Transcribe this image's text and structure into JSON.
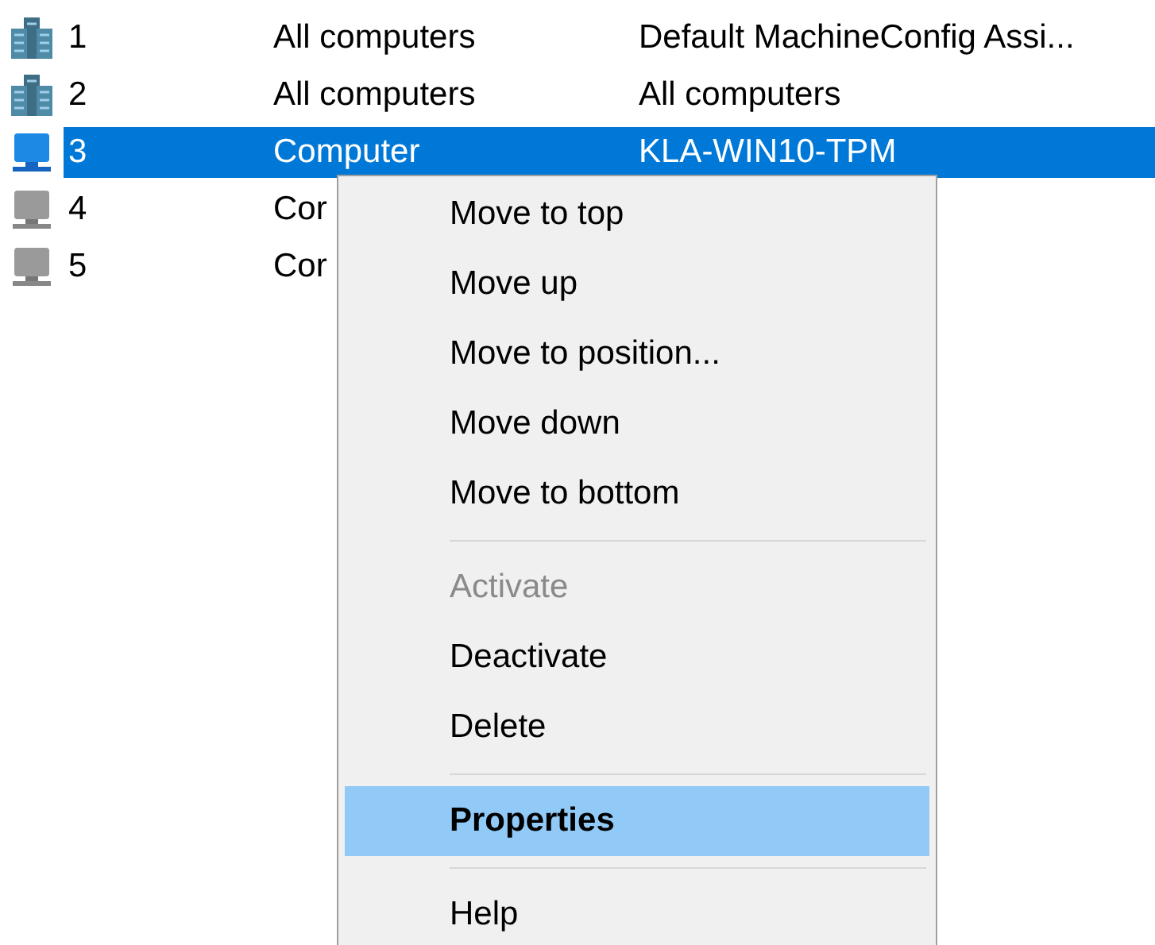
{
  "rows": [
    {
      "kind": "group",
      "number": "1",
      "scope": "All computers",
      "target": "Default MachineConfig Assi...",
      "selected": false
    },
    {
      "kind": "group",
      "number": "2",
      "scope": "All computers",
      "target": "All computers",
      "selected": false
    },
    {
      "kind": "computer",
      "number": "3",
      "scope": "Computer",
      "target": "KLA-WIN10-TPM",
      "selected": true
    },
    {
      "kind": "computer",
      "number": "4",
      "scope": "Cor",
      "selected": false
    },
    {
      "kind": "computer",
      "number": "5",
      "scope": "Cor",
      "selected": false
    }
  ],
  "context_menu": [
    {
      "kind": "item",
      "label": "Move to top",
      "disabled": false,
      "selected": false
    },
    {
      "kind": "item",
      "label": "Move up",
      "disabled": false,
      "selected": false
    },
    {
      "kind": "item",
      "label": "Move to position...",
      "disabled": false,
      "selected": false
    },
    {
      "kind": "item",
      "label": "Move down",
      "disabled": false,
      "selected": false
    },
    {
      "kind": "item",
      "label": "Move to bottom",
      "disabled": false,
      "selected": false
    },
    {
      "kind": "separator"
    },
    {
      "kind": "item",
      "label": "Activate",
      "disabled": true,
      "selected": false
    },
    {
      "kind": "item",
      "label": "Deactivate",
      "disabled": false,
      "selected": false
    },
    {
      "kind": "item",
      "label": "Delete",
      "disabled": false,
      "selected": false
    },
    {
      "kind": "separator"
    },
    {
      "kind": "item",
      "label": "Properties",
      "disabled": false,
      "selected": true,
      "bold": true
    },
    {
      "kind": "separator"
    },
    {
      "kind": "item",
      "label": "Help",
      "disabled": false,
      "selected": false
    }
  ]
}
